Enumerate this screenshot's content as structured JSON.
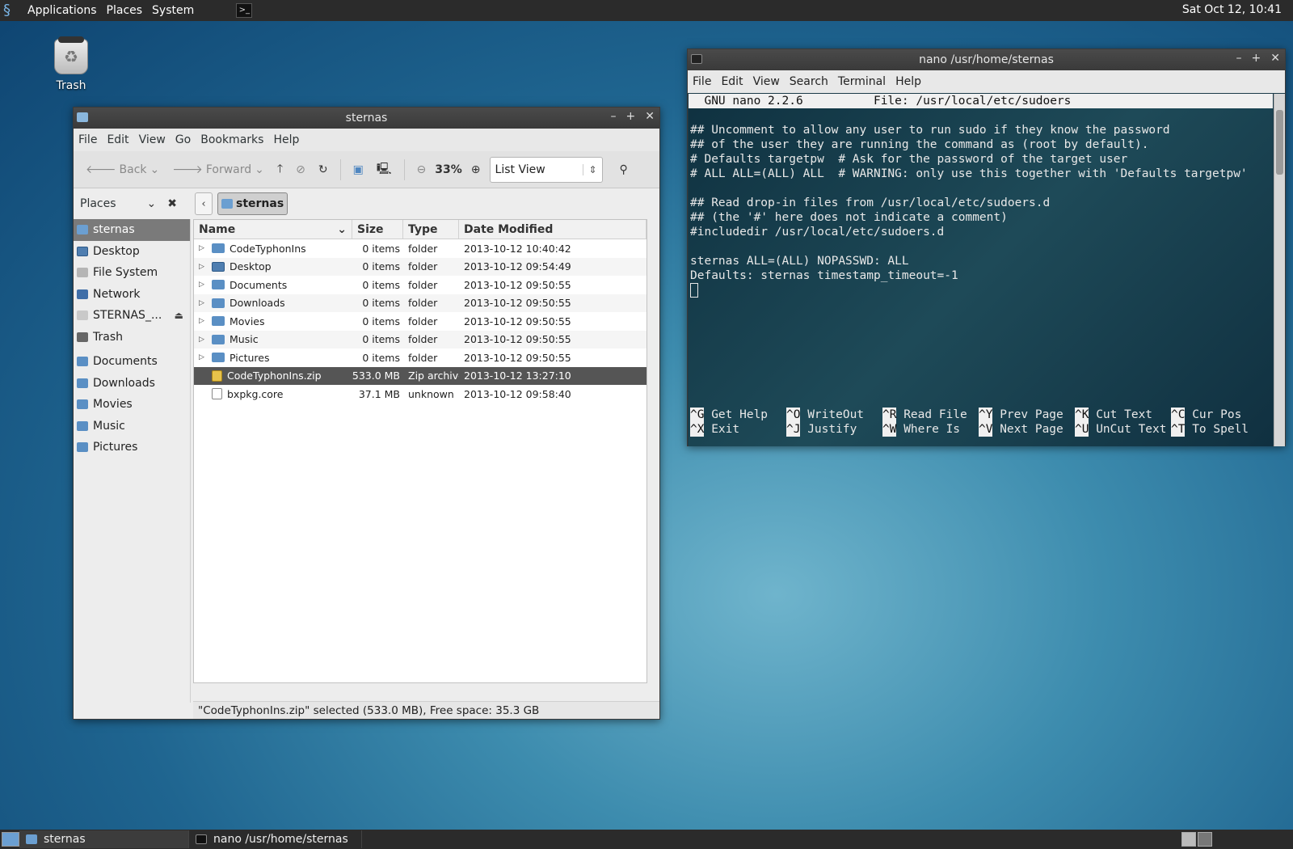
{
  "top_panel": {
    "menus": [
      "Applications",
      "Places",
      "System"
    ],
    "clock": "Sat Oct 12, 10:41"
  },
  "desktop": {
    "trash_label": "Trash"
  },
  "file_manager": {
    "title": "sternas",
    "menu": [
      "File",
      "Edit",
      "View",
      "Go",
      "Bookmarks",
      "Help"
    ],
    "toolbar": {
      "back": "Back",
      "forward": "Forward",
      "zoom": "33%",
      "view_mode": "List View"
    },
    "places_title": "Places",
    "places": [
      {
        "label": "sternas",
        "icon": "home-icon",
        "selected": true
      },
      {
        "label": "Desktop",
        "icon": "desktop-icon"
      },
      {
        "label": "File System",
        "icon": "disk-icon"
      },
      {
        "label": "Network",
        "icon": "network-icon"
      },
      {
        "label": "STERNAS_...",
        "icon": "drive-icon"
      },
      {
        "label": "Trash",
        "icon": "trash-icon"
      }
    ],
    "bookmarks": [
      "Documents",
      "Downloads",
      "Movies",
      "Music",
      "Pictures"
    ],
    "path": "sternas",
    "columns": {
      "name": "Name",
      "size": "Size",
      "type": "Type",
      "date": "Date Modified"
    },
    "files": [
      {
        "name": "CodeTyphonIns",
        "size": "0 items",
        "type": "folder",
        "date": "2013-10-12 10:40:42",
        "icon": "folder-icon"
      },
      {
        "name": "Desktop",
        "size": "0 items",
        "type": "folder",
        "date": "2013-10-12 09:54:49",
        "icon": "desktop-folder-icon"
      },
      {
        "name": "Documents",
        "size": "0 items",
        "type": "folder",
        "date": "2013-10-12 09:50:55",
        "icon": "folder-icon"
      },
      {
        "name": "Downloads",
        "size": "0 items",
        "type": "folder",
        "date": "2013-10-12 09:50:55",
        "icon": "folder-icon"
      },
      {
        "name": "Movies",
        "size": "0 items",
        "type": "folder",
        "date": "2013-10-12 09:50:55",
        "icon": "folder-icon"
      },
      {
        "name": "Music",
        "size": "0 items",
        "type": "folder",
        "date": "2013-10-12 09:50:55",
        "icon": "folder-icon"
      },
      {
        "name": "Pictures",
        "size": "0 items",
        "type": "folder",
        "date": "2013-10-12 09:50:55",
        "icon": "folder-icon"
      },
      {
        "name": "CodeTyphonIns.zip",
        "size": "533.0 MB",
        "type": "Zip archive",
        "date": "2013-10-12 13:27:10",
        "icon": "zip-icon",
        "selected": true
      },
      {
        "name": "bxpkg.core",
        "size": "37.1 MB",
        "type": "unknown",
        "date": "2013-10-12 09:58:40",
        "icon": "core-file-icon"
      }
    ],
    "status": "\"CodeTyphonIns.zip\" selected (533.0 MB), Free space: 35.3 GB"
  },
  "terminal": {
    "title": "nano  /usr/home/sternas",
    "menu": [
      "File",
      "Edit",
      "View",
      "Search",
      "Terminal",
      "Help"
    ],
    "nano_header": "  GNU nano 2.2.6          File: /usr/local/etc/sudoers",
    "lines": [
      "",
      "## Uncomment to allow any user to run sudo if they know the password",
      "## of the user they are running the command as (root by default).",
      "# Defaults targetpw  # Ask for the password of the target user",
      "# ALL ALL=(ALL) ALL  # WARNING: only use this together with 'Defaults targetpw'",
      "",
      "## Read drop-in files from /usr/local/etc/sudoers.d",
      "## (the '#' here does not indicate a comment)",
      "#includedir /usr/local/etc/sudoers.d",
      "",
      "sternas ALL=(ALL) NOPASSWD: ALL",
      "Defaults: sternas timestamp_timeout=-1"
    ],
    "help_row1": [
      {
        "key": "^G",
        "label": " Get Help"
      },
      {
        "key": "^O",
        "label": " WriteOut"
      },
      {
        "key": "^R",
        "label": " Read File"
      },
      {
        "key": "^Y",
        "label": " Prev Page"
      },
      {
        "key": "^K",
        "label": " Cut Text"
      },
      {
        "key": "^C",
        "label": " Cur Pos"
      }
    ],
    "help_row2": [
      {
        "key": "^X",
        "label": " Exit"
      },
      {
        "key": "^J",
        "label": " Justify"
      },
      {
        "key": "^W",
        "label": " Where Is"
      },
      {
        "key": "^V",
        "label": " Next Page"
      },
      {
        "key": "^U",
        "label": " UnCut Text"
      },
      {
        "key": "^T",
        "label": " To Spell"
      }
    ]
  },
  "taskbar": {
    "tasks": [
      "sternas",
      "nano  /usr/home/sternas"
    ]
  }
}
